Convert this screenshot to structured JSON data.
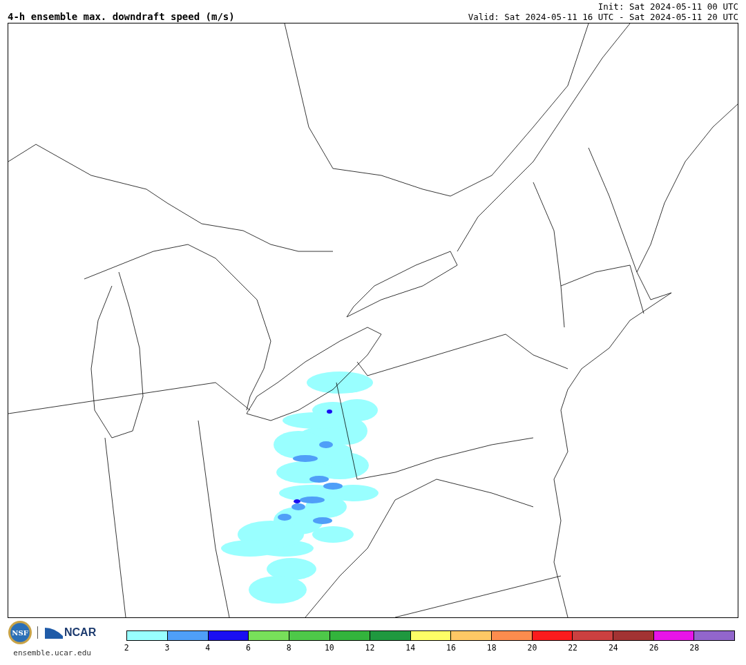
{
  "header": {
    "title": "4-h ensemble max. downdraft speed (m/s)",
    "init": "Init: Sat 2024-05-11 00 UTC",
    "valid": "Valid: Sat 2024-05-11 16 UTC - Sat 2024-05-11 20 UTC"
  },
  "footer": {
    "logos": [
      "NSF",
      "NCAR"
    ],
    "url": "ensemble.ucar.edu"
  },
  "colorbar": {
    "segments": [
      {
        "color": "#99ffff"
      },
      {
        "color": "#4f9ff8"
      },
      {
        "color": "#1a0ff2"
      },
      {
        "color": "#78e05a"
      },
      {
        "color": "#4ec849"
      },
      {
        "color": "#33b43c"
      },
      {
        "color": "#1f983f"
      },
      {
        "color": "#fefe66"
      },
      {
        "color": "#fec865"
      },
      {
        "color": "#fc8c4e"
      },
      {
        "color": "#fb1c1d"
      },
      {
        "color": "#cb4040"
      },
      {
        "color": "#a23333"
      },
      {
        "color": "#e814e8"
      },
      {
        "color": "#9266cc"
      }
    ],
    "ticks": [
      "2",
      "3",
      "4",
      "6",
      "8",
      "10",
      "12",
      "14",
      "16",
      "18",
      "20",
      "22",
      "24",
      "26",
      "28"
    ]
  }
}
